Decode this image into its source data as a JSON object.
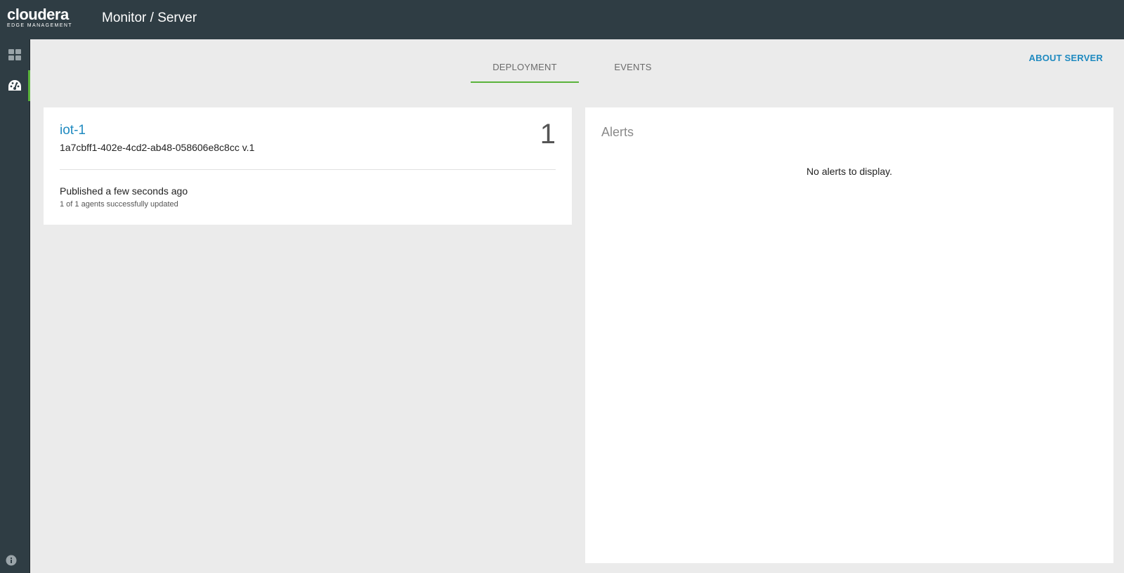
{
  "header": {
    "logo_main": "cloudera",
    "logo_sub": "EDGE MANAGEMENT",
    "title": "Monitor / Server"
  },
  "sidebar": {
    "items": [
      {
        "icon": "dashboard-grid-icon",
        "active": false
      },
      {
        "icon": "monitor-gauge-icon",
        "active": true
      }
    ],
    "footer_icon": "info-icon"
  },
  "tabs": [
    {
      "label": "DEPLOYMENT",
      "active": true
    },
    {
      "label": "EVENTS",
      "active": false
    }
  ],
  "about_link": "ABOUT SERVER",
  "deployment": {
    "name": "iot-1",
    "id": "1a7cbff1-402e-4cd2-ab48-058606e8c8cc v.1",
    "count": "1",
    "published": "Published a few seconds ago",
    "agents_status": "1 of 1 agents successfully updated"
  },
  "alerts": {
    "title": "Alerts",
    "empty_message": "No alerts to display."
  },
  "colors": {
    "header_bg": "#2f3d44",
    "accent_green": "#5ab33b",
    "link_blue": "#1f8ac0"
  }
}
